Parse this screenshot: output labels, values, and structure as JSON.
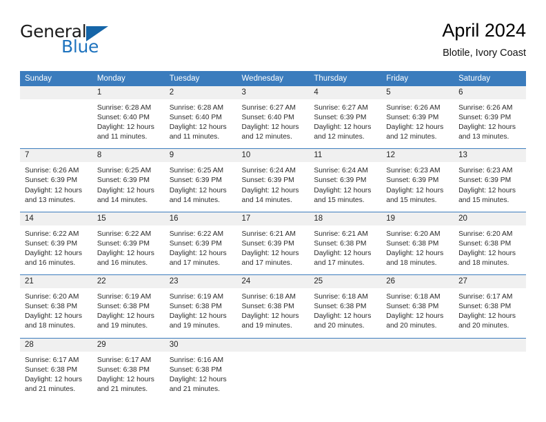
{
  "logo": {
    "primary": "General",
    "secondary": "Blue",
    "triangle_color": "#1565a8",
    "blue_color": "#1e73be"
  },
  "header": {
    "title": "April 2024",
    "subtitle": "Blotile, Ivory Coast"
  },
  "theme": {
    "header_bg": "#3b7cbd",
    "daynum_bg": "#f0f0f0",
    "row_divider": "#3b7cbd"
  },
  "weekdays": [
    "Sunday",
    "Monday",
    "Tuesday",
    "Wednesday",
    "Thursday",
    "Friday",
    "Saturday"
  ],
  "labels": {
    "sunrise_prefix": "Sunrise: ",
    "sunset_prefix": "Sunset: ",
    "daylight_prefix": "Daylight: "
  },
  "weeks": [
    [
      {
        "day": "",
        "empty": true
      },
      {
        "day": "1",
        "sunrise": "Sunrise: 6:28 AM",
        "sunset": "Sunset: 6:40 PM",
        "daylight1": "Daylight: 12 hours",
        "daylight2": "and 11 minutes."
      },
      {
        "day": "2",
        "sunrise": "Sunrise: 6:28 AM",
        "sunset": "Sunset: 6:40 PM",
        "daylight1": "Daylight: 12 hours",
        "daylight2": "and 11 minutes."
      },
      {
        "day": "3",
        "sunrise": "Sunrise: 6:27 AM",
        "sunset": "Sunset: 6:40 PM",
        "daylight1": "Daylight: 12 hours",
        "daylight2": "and 12 minutes."
      },
      {
        "day": "4",
        "sunrise": "Sunrise: 6:27 AM",
        "sunset": "Sunset: 6:39 PM",
        "daylight1": "Daylight: 12 hours",
        "daylight2": "and 12 minutes."
      },
      {
        "day": "5",
        "sunrise": "Sunrise: 6:26 AM",
        "sunset": "Sunset: 6:39 PM",
        "daylight1": "Daylight: 12 hours",
        "daylight2": "and 12 minutes."
      },
      {
        "day": "6",
        "sunrise": "Sunrise: 6:26 AM",
        "sunset": "Sunset: 6:39 PM",
        "daylight1": "Daylight: 12 hours",
        "daylight2": "and 13 minutes."
      }
    ],
    [
      {
        "day": "7",
        "sunrise": "Sunrise: 6:26 AM",
        "sunset": "Sunset: 6:39 PM",
        "daylight1": "Daylight: 12 hours",
        "daylight2": "and 13 minutes."
      },
      {
        "day": "8",
        "sunrise": "Sunrise: 6:25 AM",
        "sunset": "Sunset: 6:39 PM",
        "daylight1": "Daylight: 12 hours",
        "daylight2": "and 14 minutes."
      },
      {
        "day": "9",
        "sunrise": "Sunrise: 6:25 AM",
        "sunset": "Sunset: 6:39 PM",
        "daylight1": "Daylight: 12 hours",
        "daylight2": "and 14 minutes."
      },
      {
        "day": "10",
        "sunrise": "Sunrise: 6:24 AM",
        "sunset": "Sunset: 6:39 PM",
        "daylight1": "Daylight: 12 hours",
        "daylight2": "and 14 minutes."
      },
      {
        "day": "11",
        "sunrise": "Sunrise: 6:24 AM",
        "sunset": "Sunset: 6:39 PM",
        "daylight1": "Daylight: 12 hours",
        "daylight2": "and 15 minutes."
      },
      {
        "day": "12",
        "sunrise": "Sunrise: 6:23 AM",
        "sunset": "Sunset: 6:39 PM",
        "daylight1": "Daylight: 12 hours",
        "daylight2": "and 15 minutes."
      },
      {
        "day": "13",
        "sunrise": "Sunrise: 6:23 AM",
        "sunset": "Sunset: 6:39 PM",
        "daylight1": "Daylight: 12 hours",
        "daylight2": "and 15 minutes."
      }
    ],
    [
      {
        "day": "14",
        "sunrise": "Sunrise: 6:22 AM",
        "sunset": "Sunset: 6:39 PM",
        "daylight1": "Daylight: 12 hours",
        "daylight2": "and 16 minutes."
      },
      {
        "day": "15",
        "sunrise": "Sunrise: 6:22 AM",
        "sunset": "Sunset: 6:39 PM",
        "daylight1": "Daylight: 12 hours",
        "daylight2": "and 16 minutes."
      },
      {
        "day": "16",
        "sunrise": "Sunrise: 6:22 AM",
        "sunset": "Sunset: 6:39 PM",
        "daylight1": "Daylight: 12 hours",
        "daylight2": "and 17 minutes."
      },
      {
        "day": "17",
        "sunrise": "Sunrise: 6:21 AM",
        "sunset": "Sunset: 6:39 PM",
        "daylight1": "Daylight: 12 hours",
        "daylight2": "and 17 minutes."
      },
      {
        "day": "18",
        "sunrise": "Sunrise: 6:21 AM",
        "sunset": "Sunset: 6:38 PM",
        "daylight1": "Daylight: 12 hours",
        "daylight2": "and 17 minutes."
      },
      {
        "day": "19",
        "sunrise": "Sunrise: 6:20 AM",
        "sunset": "Sunset: 6:38 PM",
        "daylight1": "Daylight: 12 hours",
        "daylight2": "and 18 minutes."
      },
      {
        "day": "20",
        "sunrise": "Sunrise: 6:20 AM",
        "sunset": "Sunset: 6:38 PM",
        "daylight1": "Daylight: 12 hours",
        "daylight2": "and 18 minutes."
      }
    ],
    [
      {
        "day": "21",
        "sunrise": "Sunrise: 6:20 AM",
        "sunset": "Sunset: 6:38 PM",
        "daylight1": "Daylight: 12 hours",
        "daylight2": "and 18 minutes."
      },
      {
        "day": "22",
        "sunrise": "Sunrise: 6:19 AM",
        "sunset": "Sunset: 6:38 PM",
        "daylight1": "Daylight: 12 hours",
        "daylight2": "and 19 minutes."
      },
      {
        "day": "23",
        "sunrise": "Sunrise: 6:19 AM",
        "sunset": "Sunset: 6:38 PM",
        "daylight1": "Daylight: 12 hours",
        "daylight2": "and 19 minutes."
      },
      {
        "day": "24",
        "sunrise": "Sunrise: 6:18 AM",
        "sunset": "Sunset: 6:38 PM",
        "daylight1": "Daylight: 12 hours",
        "daylight2": "and 19 minutes."
      },
      {
        "day": "25",
        "sunrise": "Sunrise: 6:18 AM",
        "sunset": "Sunset: 6:38 PM",
        "daylight1": "Daylight: 12 hours",
        "daylight2": "and 20 minutes."
      },
      {
        "day": "26",
        "sunrise": "Sunrise: 6:18 AM",
        "sunset": "Sunset: 6:38 PM",
        "daylight1": "Daylight: 12 hours",
        "daylight2": "and 20 minutes."
      },
      {
        "day": "27",
        "sunrise": "Sunrise: 6:17 AM",
        "sunset": "Sunset: 6:38 PM",
        "daylight1": "Daylight: 12 hours",
        "daylight2": "and 20 minutes."
      }
    ],
    [
      {
        "day": "28",
        "sunrise": "Sunrise: 6:17 AM",
        "sunset": "Sunset: 6:38 PM",
        "daylight1": "Daylight: 12 hours",
        "daylight2": "and 21 minutes."
      },
      {
        "day": "29",
        "sunrise": "Sunrise: 6:17 AM",
        "sunset": "Sunset: 6:38 PM",
        "daylight1": "Daylight: 12 hours",
        "daylight2": "and 21 minutes."
      },
      {
        "day": "30",
        "sunrise": "Sunrise: 6:16 AM",
        "sunset": "Sunset: 6:38 PM",
        "daylight1": "Daylight: 12 hours",
        "daylight2": "and 21 minutes."
      },
      {
        "day": "",
        "empty": true
      },
      {
        "day": "",
        "empty": true
      },
      {
        "day": "",
        "empty": true
      },
      {
        "day": "",
        "empty": true
      }
    ]
  ]
}
